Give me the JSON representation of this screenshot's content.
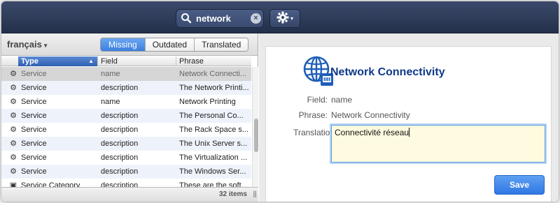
{
  "toolbar": {
    "search": {
      "value": "network",
      "placeholder": ""
    },
    "clear_glyph": "×",
    "gear_caret": "▾"
  },
  "left": {
    "language": "français",
    "language_caret": "▾",
    "filters": [
      "Missing",
      "Outdated",
      "Translated"
    ],
    "active_filter": "Missing",
    "columns": {
      "type": "Type",
      "field": "Field",
      "phrase": "Phrase"
    },
    "sort_indicator": "▲",
    "rows": [
      {
        "icon": "gears-icon",
        "type": "Service",
        "field": "name",
        "phrase": "Network Connecti..."
      },
      {
        "icon": "gears-icon",
        "type": "Service",
        "field": "description",
        "phrase": "The Network Printi..."
      },
      {
        "icon": "gears-icon",
        "type": "Service",
        "field": "name",
        "phrase": "Network Printing"
      },
      {
        "icon": "gears-icon",
        "type": "Service",
        "field": "description",
        "phrase": "The Personal Co..."
      },
      {
        "icon": "gears-icon",
        "type": "Service",
        "field": "description",
        "phrase": "The Rack Space s..."
      },
      {
        "icon": "gears-icon",
        "type": "Service",
        "field": "description",
        "phrase": "The Unix Server s..."
      },
      {
        "icon": "gears-icon",
        "type": "Service",
        "field": "description",
        "phrase": "The Virtualization ..."
      },
      {
        "icon": "gears-icon",
        "type": "Service",
        "field": "description",
        "phrase": "The Windows Ser..."
      },
      {
        "icon": "category-icon",
        "type": "Service Category",
        "field": "description",
        "phrase": "These are the soft..."
      }
    ],
    "item_count": "32 items",
    "resize_grip": "|||"
  },
  "detail": {
    "title": "Network Connectivity",
    "field_label": "Field:",
    "field_value": "name",
    "phrase_label": "Phrase:",
    "phrase_value": "Network Connectivity",
    "translation_label": "Translation",
    "translation_value": "Connectivité réseau",
    "save_label": "Save"
  },
  "colors": {
    "accent": "#3d7fe0",
    "title": "#0f3a8a",
    "toolbar": "#23304a"
  }
}
